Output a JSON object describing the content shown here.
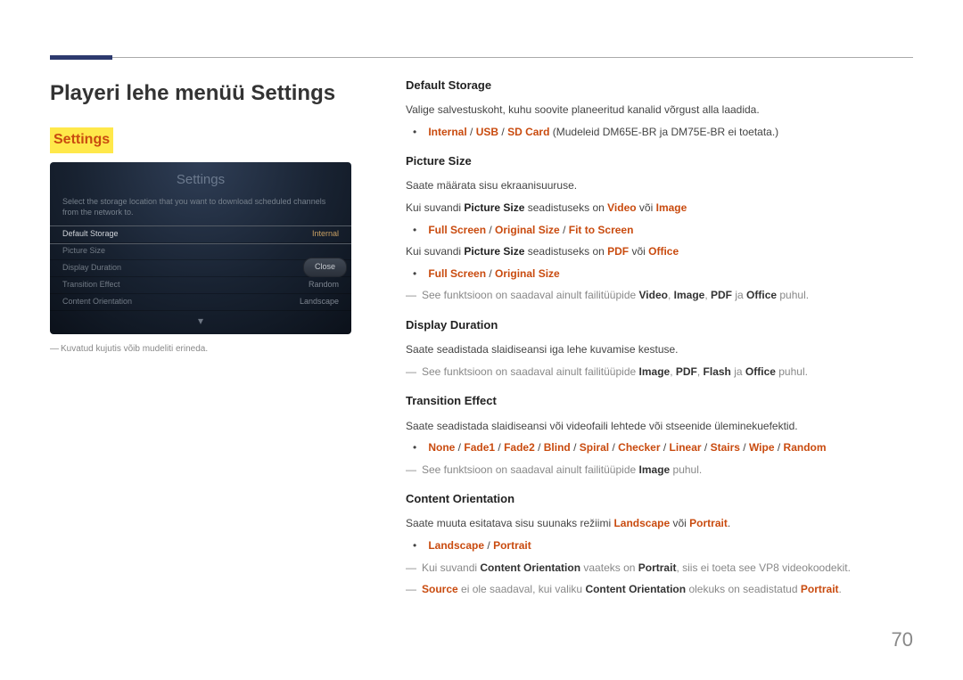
{
  "page_number": "70",
  "title": "Playeri lehe menüü Settings",
  "highlight": "Settings",
  "screen": {
    "title": "Settings",
    "subtitle": "Select the storage location that you want to download scheduled channels from the network to.",
    "rows": [
      {
        "label": "Default Storage",
        "value": "Internal",
        "selected": true
      },
      {
        "label": "Picture Size",
        "value": "",
        "selected": false
      },
      {
        "label": "Display Duration",
        "value": "",
        "selected": false
      },
      {
        "label": "Transition Effect",
        "value": "Random",
        "selected": false
      },
      {
        "label": "Content Orientation",
        "value": "Landscape",
        "selected": false
      }
    ],
    "close": "Close"
  },
  "caption": "Kuvatud kujutis võib mudeliti erineda.",
  "sections": {
    "default_storage": {
      "heading": "Default Storage",
      "desc": "Valige salvestuskoht, kuhu soovite planeeritud kanalid võrgust alla laadida.",
      "bullet_pre": "",
      "bullet_opts": [
        "Internal",
        "USB",
        "SD Card"
      ],
      "bullet_post": " (Mudeleid DM65E-BR ja DM75E-BR ei toetata.)"
    },
    "picture_size": {
      "heading": "Picture Size",
      "desc1": "Saate määrata sisu ekraanisuuruse.",
      "line2_pre": "Kui suvandi ",
      "line2_b": "Picture Size",
      "line2_mid": " seadistuseks on ",
      "line2_r1": "Video",
      "line2_voi": " või ",
      "line2_r2": "Image",
      "opts1": [
        "Full Screen",
        "Original Size",
        "Fit to Screen"
      ],
      "line3_pre": "Kui suvandi ",
      "line3_b": "Picture Size",
      "line3_mid": " seadistuseks on ",
      "line3_r1": "PDF",
      "line3_voi": " või ",
      "line3_r2": "Office",
      "opts2": [
        "Full Screen",
        "Original Size"
      ],
      "note_pre": "See funktsioon on saadaval ainult failitüüpide ",
      "note_terms": [
        "Video",
        "Image",
        "PDF",
        "Office"
      ],
      "note_post": " puhul."
    },
    "display_duration": {
      "heading": "Display Duration",
      "desc": "Saate seadistada slaidiseansi iga lehe kuvamise kestuse.",
      "note_pre": "See funktsioon on saadaval ainult failitüüpide ",
      "note_terms": [
        "Image",
        "PDF",
        "Flash",
        "Office"
      ],
      "note_post": " puhul."
    },
    "transition_effect": {
      "heading": "Transition Effect",
      "desc": "Saate seadistada slaidiseansi või videofaili lehtede või stseenide üleminekuefektid.",
      "opts": [
        "None",
        "Fade1",
        "Fade2",
        "Blind",
        "Spiral",
        "Checker",
        "Linear",
        "Stairs",
        "Wipe",
        "Random"
      ],
      "note_pre": "See funktsioon on saadaval ainult failitüüpide ",
      "note_terms": [
        "Image"
      ],
      "note_post": " puhul."
    },
    "content_orientation": {
      "heading": "Content Orientation",
      "desc_pre": "Saate muuta esitatava sisu suunaks režiimi ",
      "desc_r1": "Landscape",
      "desc_voi": " või ",
      "desc_r2": "Portrait",
      "opts": [
        "Landscape",
        "Portrait"
      ],
      "note1_pre": "Kui suvandi ",
      "note1_b1": "Content Orientation",
      "note1_mid": " vaateks on ",
      "note1_b2": "Portrait",
      "note1_post": ", siis ei toeta see VP8 videokoodekit.",
      "note2_r": "Source",
      "note2_mid1": " ei ole saadaval, kui valiku ",
      "note2_b": "Content Orientation",
      "note2_mid2": " olekuks on seadistatud ",
      "note2_r2": "Portrait",
      "note2_post": "."
    }
  }
}
